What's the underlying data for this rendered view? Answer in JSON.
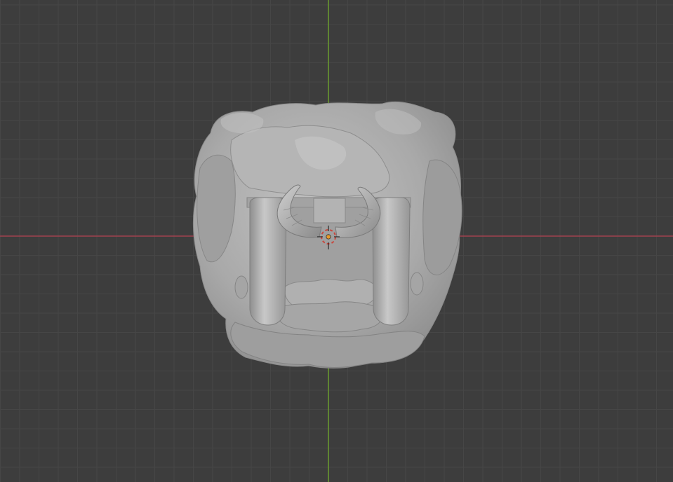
{
  "viewport": {
    "background_color": "#3d3d3d",
    "grid_minor_color": "#464646",
    "grid_major_color": "#4d4d4d",
    "x_axis_color": "#a1414f",
    "y_axis_color": "#6b9b2f",
    "mesh_base_color": "#a8a8a8",
    "mesh_shadow_color": "#7c7c7c",
    "mesh_highlight_color": "#cfcfcf",
    "origin_color": "#e69a2b",
    "cursor_colors": [
      "#e6e6e6",
      "#c8483e"
    ]
  },
  "scene": {
    "object_name": "sculpted-rock-shrine-with-horns",
    "object_icon": "mesh-object-icon",
    "cursor_icon": "3d-cursor-icon",
    "origin_icon": "object-origin-icon"
  }
}
